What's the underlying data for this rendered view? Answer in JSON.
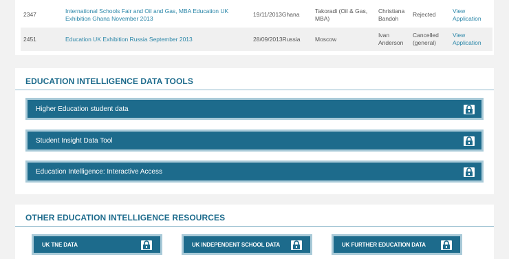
{
  "applications": {
    "rows": [
      {
        "id": "2347",
        "event": "International Schools Fair and Oil and Gas, MBA Education UK Exhibition Ghana November 2013",
        "date": "19/11/2013",
        "country": "Ghana",
        "city": "Takoradi (Oil & Gas, MBA)",
        "contact": "Christiana Bandoh",
        "status": "Rejected",
        "action": "View Application"
      },
      {
        "id": "2451",
        "event": "Education UK Exhibition Russia September 2013",
        "date": "28/09/2013",
        "country": "Russia",
        "city": "Moscow",
        "contact": "Ivan Anderson",
        "status": "Cancelled (general)",
        "action": "View Application"
      }
    ]
  },
  "data_tools": {
    "title": "EDUCATION INTELLIGENCE DATA TOOLS",
    "items": [
      {
        "label": "Higher Education student data",
        "icon": "lock-icon"
      },
      {
        "label": "Student Insight Data Tool",
        "icon": "lock-icon"
      },
      {
        "label": "Education Intelligence: Interactive Access",
        "icon": "lock-icon"
      }
    ]
  },
  "resources": {
    "title": "OTHER EDUCATION INTELLIGENCE RESOURCES",
    "items": [
      {
        "label": "UK TNE DATA",
        "icon": "lock-icon"
      },
      {
        "label": "UK INDEPENDENT SCHOOL DATA",
        "icon": "lock-icon"
      },
      {
        "label": "UK FURTHER EDUCATION DATA",
        "icon": "lock-icon"
      }
    ]
  },
  "colors": {
    "accent": "#1d6b8c",
    "button_border": "#a9cad8",
    "link": "#2a86a8",
    "background": "#f2f2f2"
  }
}
